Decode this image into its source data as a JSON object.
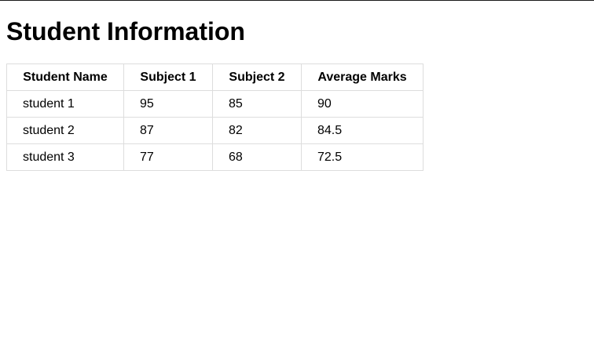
{
  "page": {
    "title": "Student Information"
  },
  "table": {
    "headers": [
      "Student Name",
      "Subject 1",
      "Subject 2",
      "Average Marks"
    ],
    "rows": [
      [
        "student 1",
        "95",
        "85",
        "90"
      ],
      [
        "student 2",
        "87",
        "82",
        "84.5"
      ],
      [
        "student 3",
        "77",
        "68",
        "72.5"
      ]
    ]
  }
}
